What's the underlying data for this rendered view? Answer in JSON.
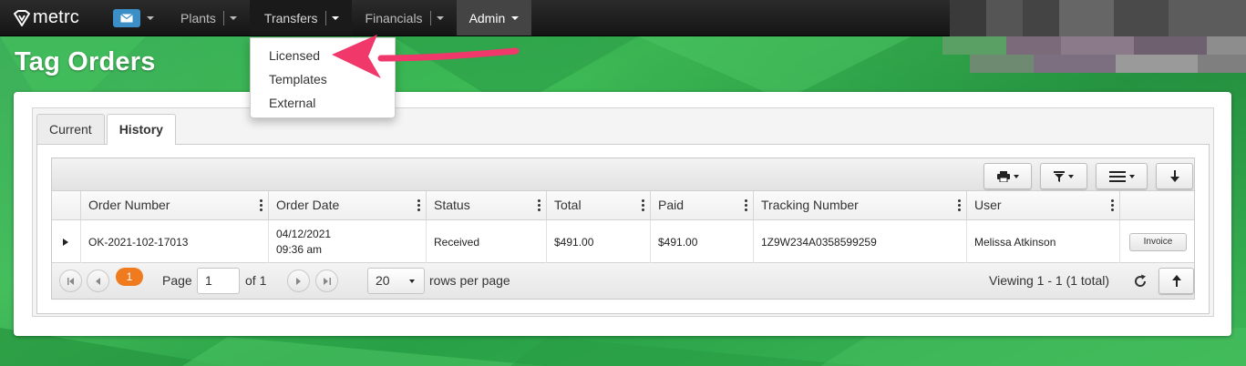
{
  "app": {
    "brand": "metrc",
    "page_title": "Tag Orders"
  },
  "navbar": {
    "items": [
      {
        "label": "Plants"
      },
      {
        "label": "Transfers"
      },
      {
        "label": "Financials"
      },
      {
        "label": "Admin"
      }
    ]
  },
  "transfers_menu": {
    "items": [
      "Licensed",
      "Templates",
      "External"
    ]
  },
  "tabs": [
    {
      "label": "Current",
      "active": false
    },
    {
      "label": "History",
      "active": true
    }
  ],
  "grid": {
    "columns": [
      "Order Number",
      "Order Date",
      "Status",
      "Total",
      "Paid",
      "Tracking Number",
      "User"
    ],
    "rows": [
      {
        "order_number": "OK-2021-102-17013",
        "order_date": "04/12/2021",
        "order_time": "09:36 am",
        "status": "Received",
        "total": "$491.00",
        "paid": "$491.00",
        "tracking_number": "1Z9W234A0358599259",
        "user": "Melissa Atkinson",
        "action_label": "Invoice"
      }
    ]
  },
  "pager": {
    "current_page_badge": "1",
    "page_label": "Page",
    "page_value": "1",
    "of_label": "of 1",
    "rows_per_page_value": "20",
    "rows_per_page_label": "rows per page",
    "viewing_text": "Viewing 1 - 1 (1 total)"
  },
  "colors": {
    "background_green": "#3cb957",
    "navbar": "#1f1f1f",
    "mail_button": "#3b8ec6",
    "page_badge": "#f07a1e",
    "annotation_arrow": "#f0386b"
  },
  "icons": [
    "metrc-logo-icon",
    "mail-icon",
    "print-icon",
    "filter-icon",
    "columns-menu-icon",
    "download-icon",
    "refresh-icon",
    "upload-icon",
    "first-page-icon",
    "prev-page-icon",
    "next-page-icon",
    "last-page-icon"
  ]
}
